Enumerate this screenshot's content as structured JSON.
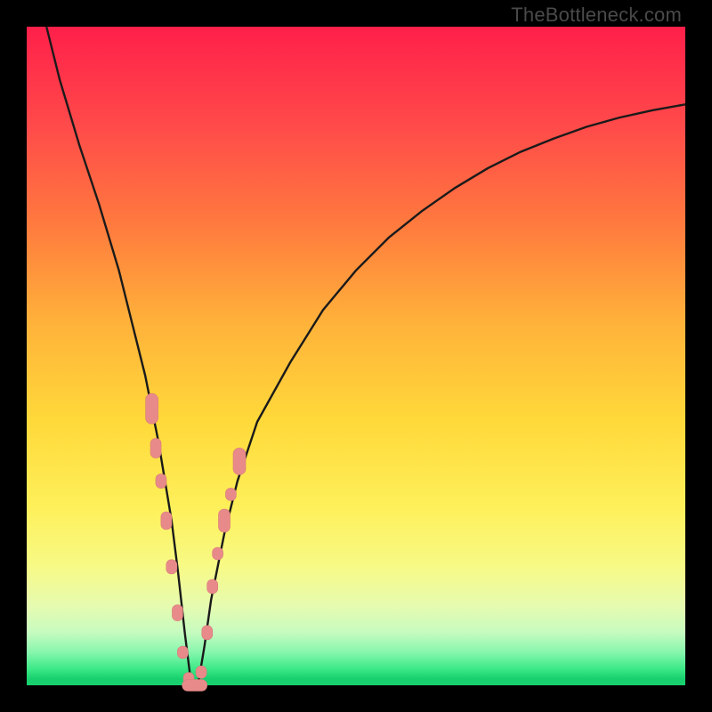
{
  "watermark": "TheBottleneck.com",
  "colors": {
    "frame": "#000000",
    "curve_stroke": "#1a1a1a",
    "marker_fill": "#e98a8a",
    "marker_stroke": "#d77a7a"
  },
  "chart_data": {
    "type": "line",
    "title": "",
    "xlabel": "",
    "ylabel": "",
    "xlim": [
      0,
      100
    ],
    "ylim": [
      0,
      100
    ],
    "grid": false,
    "series": [
      {
        "name": "bottleneck-curve",
        "description": "V-shaped bottleneck curve; y ≈ 0 near x ≈ 25, rising steeply to the left edge (y≈100) and more gradually toward the right (y≈88 at x=100).",
        "x": [
          3,
          5,
          8,
          11,
          14,
          16,
          18,
          19,
          20,
          21,
          22,
          23,
          24,
          25,
          26,
          27,
          28,
          30,
          32,
          35,
          40,
          45,
          50,
          55,
          60,
          65,
          70,
          75,
          80,
          85,
          90,
          95,
          100
        ],
        "y": [
          100,
          92,
          82,
          73,
          63,
          55,
          47,
          42,
          37,
          31,
          25,
          17,
          8,
          0,
          0,
          6,
          13,
          23,
          31,
          40,
          49,
          57,
          63,
          68,
          72,
          75.5,
          78.5,
          81,
          83,
          84.8,
          86.2,
          87.3,
          88.2
        ]
      }
    ],
    "markers": {
      "description": "Pink lozenge markers clustered near the bottom of the V on both arms.",
      "points": [
        {
          "x": 19.0,
          "y": 42,
          "w": 14,
          "h": 34
        },
        {
          "x": 19.6,
          "y": 36,
          "w": 12,
          "h": 22
        },
        {
          "x": 20.4,
          "y": 31,
          "w": 12,
          "h": 16
        },
        {
          "x": 21.2,
          "y": 25,
          "w": 12,
          "h": 20
        },
        {
          "x": 22.0,
          "y": 18,
          "w": 12,
          "h": 16
        },
        {
          "x": 22.9,
          "y": 11,
          "w": 12,
          "h": 18
        },
        {
          "x": 23.7,
          "y": 5,
          "w": 12,
          "h": 14
        },
        {
          "x": 24.6,
          "y": 1,
          "w": 12,
          "h": 14
        },
        {
          "x": 25.5,
          "y": 0,
          "w": 28,
          "h": 13
        },
        {
          "x": 26.5,
          "y": 2,
          "w": 12,
          "h": 14
        },
        {
          "x": 27.4,
          "y": 8,
          "w": 12,
          "h": 16
        },
        {
          "x": 28.2,
          "y": 15,
          "w": 12,
          "h": 16
        },
        {
          "x": 29.0,
          "y": 20,
          "w": 12,
          "h": 14
        },
        {
          "x": 30.0,
          "y": 25,
          "w": 13,
          "h": 26
        },
        {
          "x": 31.0,
          "y": 29,
          "w": 12,
          "h": 14
        },
        {
          "x": 32.3,
          "y": 34,
          "w": 14,
          "h": 30
        }
      ]
    }
  }
}
